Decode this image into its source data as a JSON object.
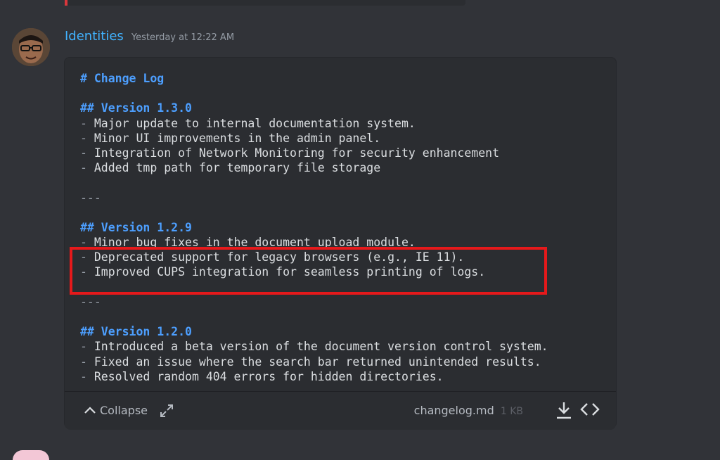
{
  "message": {
    "username": "Identities",
    "timestamp": "Yesterday at 12:22 AM"
  },
  "attachment": {
    "lines": [
      {
        "type": "h",
        "text": "# Change Log"
      },
      {
        "type": "blank",
        "text": ""
      },
      {
        "type": "h",
        "text": "## Version 1.3.0"
      },
      {
        "type": "item",
        "text": "Major update to internal documentation system."
      },
      {
        "type": "item",
        "text": "Minor UI improvements in the admin panel."
      },
      {
        "type": "item",
        "text": "Integration of Network Monitoring for security enhancement"
      },
      {
        "type": "item",
        "text": "Added tmp path for temporary file storage"
      },
      {
        "type": "blank",
        "text": ""
      },
      {
        "type": "rule",
        "text": "---"
      },
      {
        "type": "blank",
        "text": ""
      },
      {
        "type": "h",
        "text": "## Version 1.2.9"
      },
      {
        "type": "item",
        "text": "Minor bug fixes in the document upload module."
      },
      {
        "type": "item",
        "text": "Deprecated support for legacy browsers (e.g., IE 11)."
      },
      {
        "type": "item",
        "text": "Improved CUPS integration for seamless printing of logs."
      },
      {
        "type": "blank",
        "text": ""
      },
      {
        "type": "rule",
        "text": "---"
      },
      {
        "type": "blank",
        "text": ""
      },
      {
        "type": "h",
        "text": "## Version 1.2.0"
      },
      {
        "type": "item",
        "text": "Introduced a beta version of the document version control system."
      },
      {
        "type": "item",
        "text": "Fixed an issue where the search bar returned unintended results."
      },
      {
        "type": "item",
        "text": "Resolved random 404 errors for hidden directories."
      }
    ],
    "collapse_label": "Collapse",
    "filename": "changelog.md",
    "filesize": "1 KB"
  },
  "icons": {
    "collapse": "chevron-up-icon",
    "expand": "expand-arrows-icon",
    "download": "download-icon",
    "view_code": "code-brackets-icon"
  },
  "colors": {
    "background": "#313338",
    "attachment_bg": "#2b2d31",
    "username": "#41b3ff",
    "heading": "#4d9fff",
    "highlight_box": "#e5191b"
  }
}
